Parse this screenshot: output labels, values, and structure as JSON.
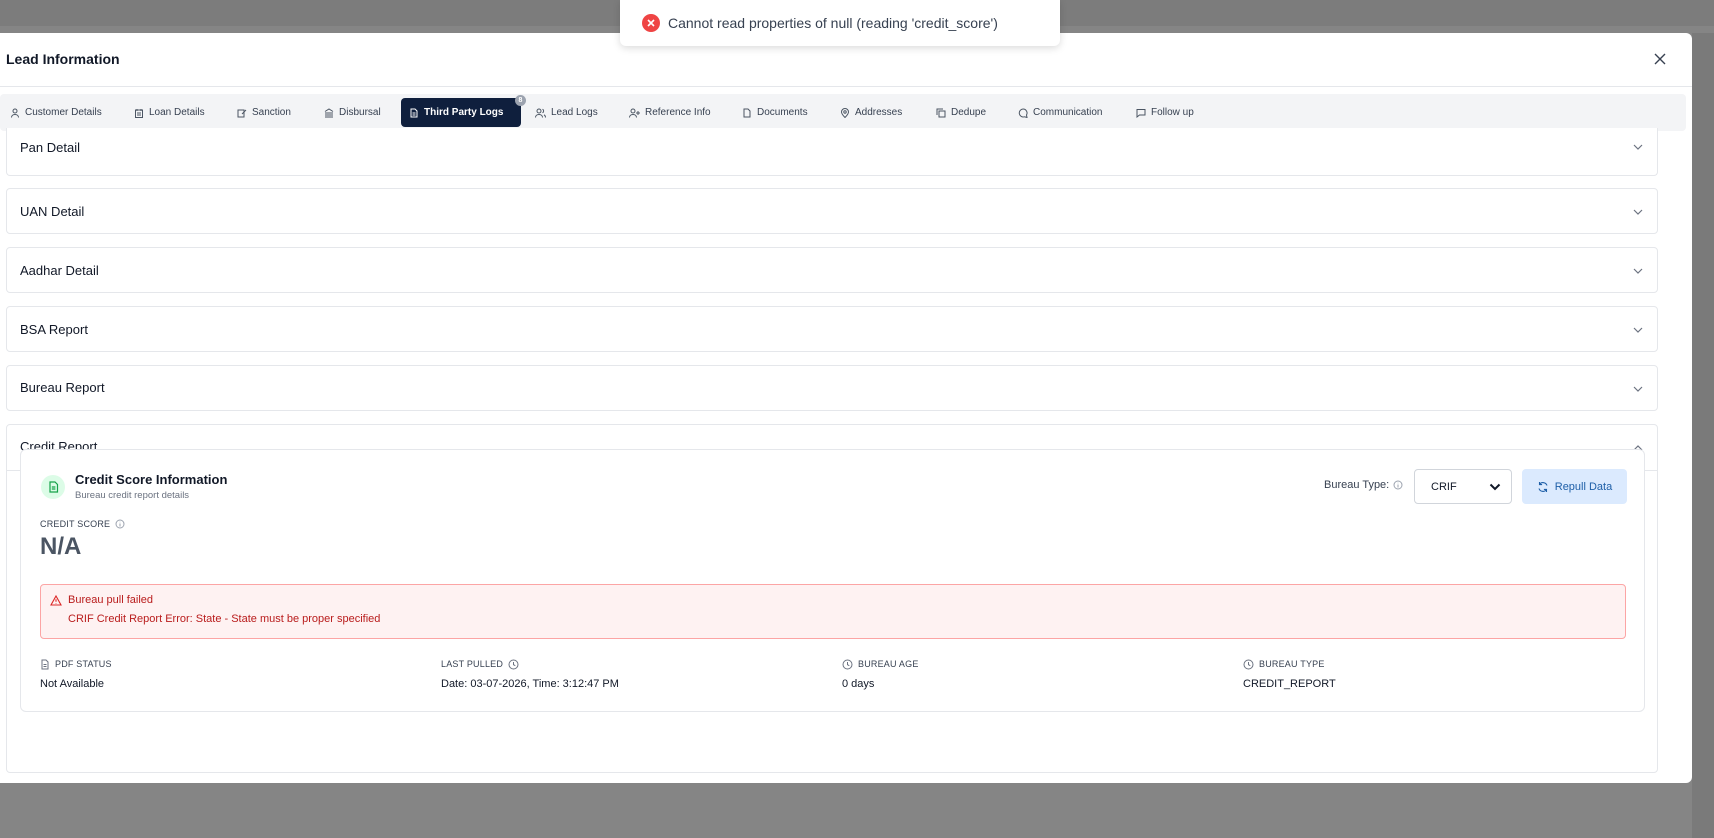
{
  "toast": {
    "message": "Cannot read properties of null (reading 'credit_score')",
    "icon": "error-circle-icon",
    "color": "#ef4444"
  },
  "modal": {
    "title": "Lead Information",
    "tabs": [
      {
        "label": "Customer Details",
        "icon": "user-icon"
      },
      {
        "label": "Loan Details",
        "icon": "loan-icon"
      },
      {
        "label": "Sanction",
        "icon": "edit-icon"
      },
      {
        "label": "Disbursal",
        "icon": "bank-icon"
      },
      {
        "label": "Third Party Logs",
        "icon": "file-icon",
        "active": true,
        "badge": "8"
      },
      {
        "label": "Lead Logs",
        "icon": "users-icon"
      },
      {
        "label": "Reference Info",
        "icon": "user-plus-icon"
      },
      {
        "label": "Documents",
        "icon": "document-icon"
      },
      {
        "label": "Addresses",
        "icon": "map-pin-icon"
      },
      {
        "label": "Dedupe",
        "icon": "copy-icon"
      },
      {
        "label": "Communication",
        "icon": "chat-icon"
      },
      {
        "label": "Follow up",
        "icon": "message-square-icon"
      }
    ],
    "accordions": [
      {
        "title": "Pan Detail",
        "expanded": false
      },
      {
        "title": "UAN Detail",
        "expanded": false
      },
      {
        "title": "Aadhar Detail",
        "expanded": false
      },
      {
        "title": "BSA Report",
        "expanded": false
      },
      {
        "title": "Bureau Report",
        "expanded": false
      },
      {
        "title": "Credit Report",
        "expanded": true
      }
    ]
  },
  "credit": {
    "title": "Credit Score Information",
    "subtitle": "Bureau credit report details",
    "bureau_type_label": "Bureau Type:",
    "bureau_type_value": "CRIF",
    "repull_label": "Repull Data",
    "score_label": "CREDIT SCORE",
    "score_value": "N/A",
    "error_title": "Bureau pull failed",
    "error_message": "CRIF Credit Report Error: State - State must be proper specified",
    "meta": [
      {
        "label": "PDF STATUS",
        "value": "Not Available",
        "icon": "file-icon"
      },
      {
        "label": "LAST PULLED",
        "value": "Date: 03-07-2026, Time: 3:12:47 PM",
        "icon": "clock-icon"
      },
      {
        "label": "BUREAU AGE",
        "value": "0 days",
        "icon": "clock-icon"
      },
      {
        "label": "BUREAU TYPE",
        "value": "CREDIT_REPORT",
        "icon": "clock-icon"
      }
    ]
  },
  "colors": {
    "active_tab": "#0f1f3d",
    "accent": "#1e5fa8",
    "error": "#b91c1c",
    "success": "#16a34a"
  }
}
